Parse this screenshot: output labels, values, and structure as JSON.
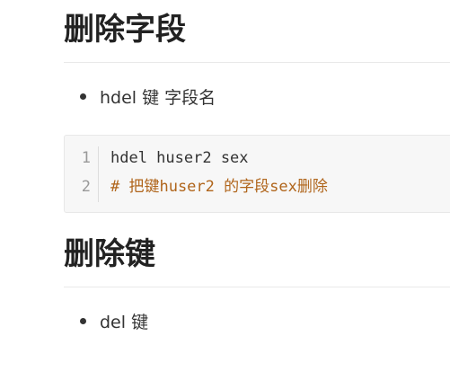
{
  "section1": {
    "title": "删除字段",
    "bullet": "hdel 键 字段名",
    "code": {
      "line_numbers": [
        "1",
        "2"
      ],
      "lines": [
        "hdel huser2 sex",
        "# 把键huser2 的字段sex删除"
      ]
    }
  },
  "section2": {
    "title": "删除键",
    "bullet": "del 键"
  },
  "colors": {
    "heading": "#222222",
    "text": "#333333",
    "code_background": "#f7f7f7",
    "comment": "#b0651b",
    "line_number": "#999999",
    "divider": "#e9e9e9"
  }
}
